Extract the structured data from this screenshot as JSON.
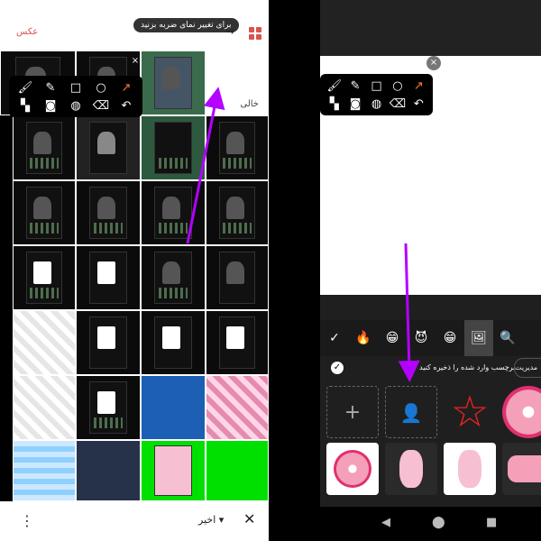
{
  "left": {
    "header": {
      "photo_label": "عکس",
      "tooltip": "برای تغییر نمای ضربه بزنید",
      "arrow_icon": "curved-arrow-icon",
      "view_icon": "grid-view-icon"
    },
    "empty_label": "خالی",
    "bottom": {
      "more_icon": "more-vertical-icon",
      "recent_label": "اخیر ▾",
      "close_icon": "close-icon"
    }
  },
  "toolbar": {
    "row1": [
      "brush",
      "magic-brush",
      "square",
      "circle",
      "arrow"
    ],
    "row2": [
      "checker",
      "camera",
      "color-wheel",
      "eraser",
      "undo"
    ],
    "close": "×"
  },
  "right": {
    "emoji_tabs": [
      "✓",
      "🔥",
      "😁",
      "😈",
      "😁",
      "🖼",
      "🔍"
    ],
    "save_text": "برچسب وارد شده را ذخیره کنید",
    "manage_label": "مدیریت",
    "add_icon": "+",
    "nav": [
      "◀",
      "⬤",
      "■"
    ]
  },
  "colors": {
    "accent": "#d9534f",
    "pointer": "#b300ff",
    "orange": "#ff7b2c"
  }
}
